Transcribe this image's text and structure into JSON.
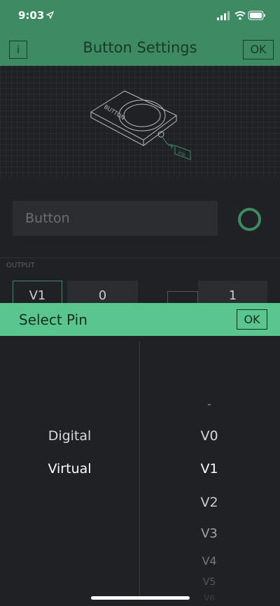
{
  "status_bar": {
    "time": "9:03",
    "location_icon": "location-arrow-icon",
    "signal_icon": "signal-icon",
    "wifi_icon": "wifi-icon",
    "battery_icon": "battery-icon"
  },
  "header": {
    "info_label": "i",
    "title": "Button Settings",
    "ok_label": "OK"
  },
  "illustration": {
    "device_label": "BUTTON",
    "pin_label": "PIN"
  },
  "settings": {
    "name_placeholder": "Button",
    "accent_color": "#3e8a63",
    "output_label": "OUTPUT",
    "pin_value": "V1",
    "min_value": "0",
    "max_value": "1"
  },
  "sheet": {
    "title": "Select Pin",
    "ok_label": "OK",
    "modes": [
      "Digital",
      "Virtual"
    ],
    "selected_mode": "Virtual",
    "pins": [
      "-",
      "V0",
      "V1",
      "V2",
      "V3",
      "V4",
      "V5",
      "V6"
    ],
    "selected_pin": "V1"
  }
}
